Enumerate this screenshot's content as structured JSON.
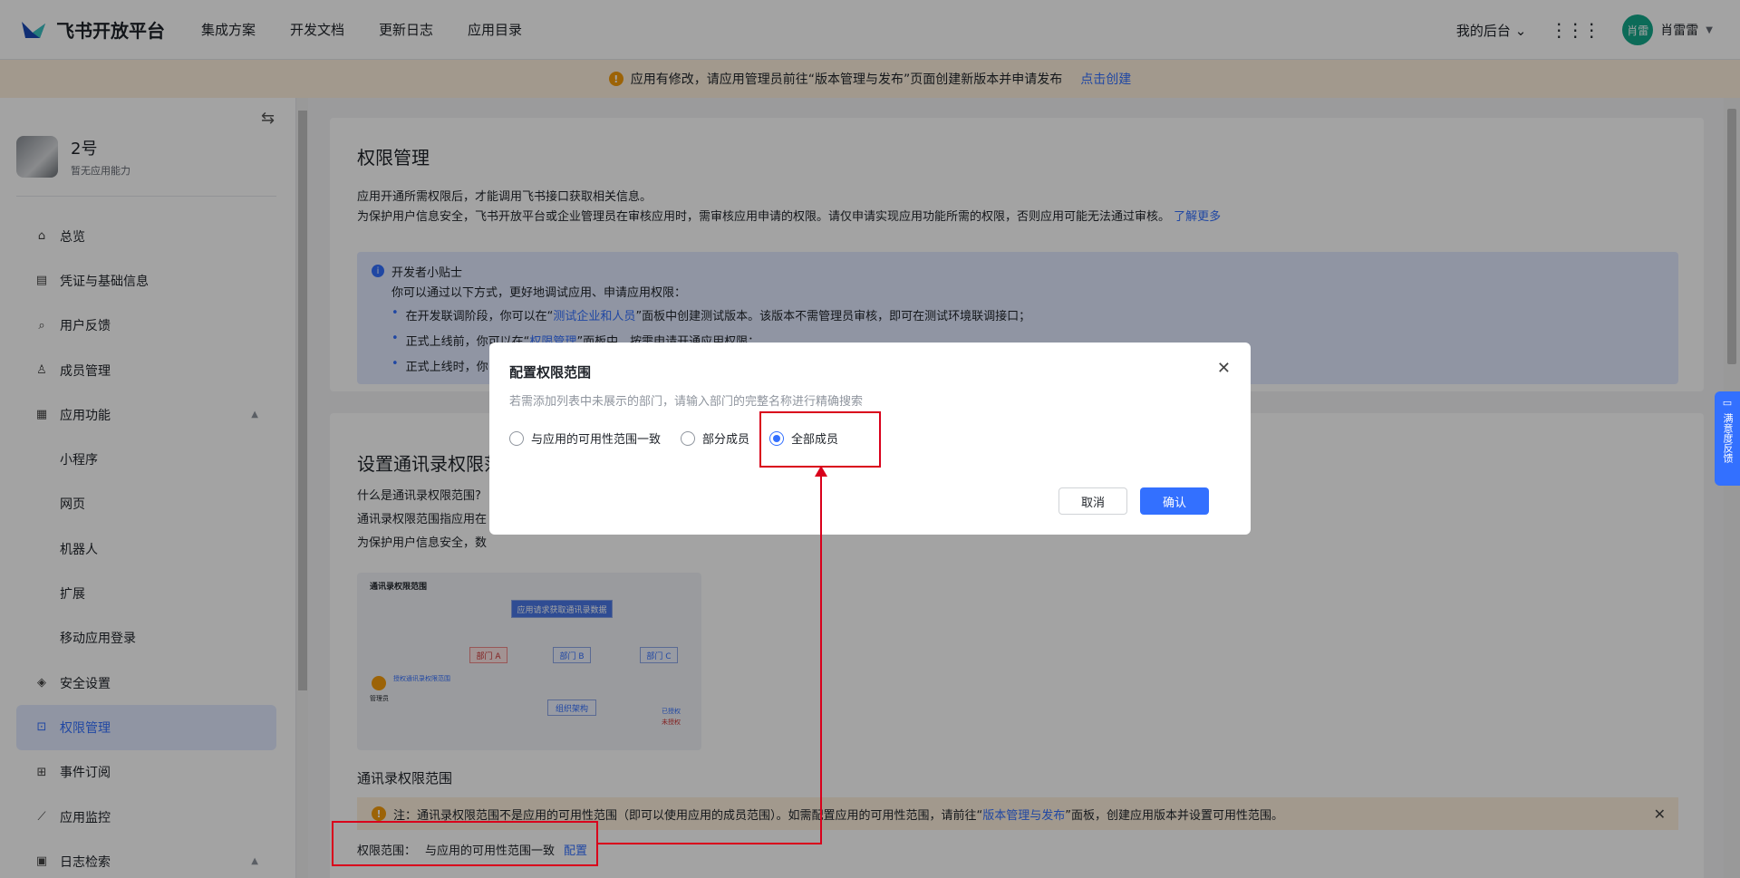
{
  "topbar": {
    "logo_text": "飞书开放平台",
    "nav": [
      "集成方案",
      "开发文档",
      "更新日志",
      "应用目录"
    ],
    "console": "我的后台",
    "avatar_text": "肖雷",
    "user_name": "肖雷雷"
  },
  "banner": {
    "text": "应用有修改，请应用管理员前往“版本管理与发布”页面创建新版本并申请发布",
    "link": "点击创建"
  },
  "sidebar": {
    "app_name": "2号",
    "app_sub": "暂无应用能力",
    "items": [
      {
        "label": "总览",
        "icon": "home-icon"
      },
      {
        "label": "凭证与基础信息",
        "icon": "credential-icon"
      },
      {
        "label": "用户反馈",
        "icon": "feedback-icon"
      },
      {
        "label": "成员管理",
        "icon": "user-icon"
      },
      {
        "label": "应用功能",
        "icon": "apps-icon"
      },
      {
        "label": "小程序"
      },
      {
        "label": "网页"
      },
      {
        "label": "机器人"
      },
      {
        "label": "扩展"
      },
      {
        "label": "移动应用登录"
      },
      {
        "label": "安全设置",
        "icon": "shield-icon"
      },
      {
        "label": "权限管理",
        "icon": "lock-icon"
      },
      {
        "label": "事件订阅",
        "icon": "event-icon"
      },
      {
        "label": "应用监控",
        "icon": "chart-icon"
      },
      {
        "label": "日志检索",
        "icon": "log-icon"
      }
    ]
  },
  "main": {
    "title": "权限管理",
    "desc1": "应用开通所需权限后，才能调用飞书接口获取相关信息。",
    "desc2": "为保护用户信息安全，飞书开放平台或企业管理员在审核应用时，需审核应用申请的权限。请仅申请实现应用功能所需的权限，否则应用可能无法通过审核。",
    "learn_more": "了解更多",
    "tip_title": "开发者小贴士",
    "tip_line": "你可以通过以下方式，更好地调试应用、申请应用权限：",
    "tip_b1_pre": "在开发联调阶段，你可以在“",
    "tip_b1_link": "测试企业和人员",
    "tip_b1_post": "”面板中创建测试版本。该版本不需管理员审核，即可在测试环境联调接口；",
    "tip_b2_pre": "正式上线前，你可以在“",
    "tip_b2_link": "权限管理",
    "tip_b2_post": "”面板中，按需申请开通应用权限；",
    "tip_b3": "正式上线时，你",
    "section_title": "设置通讯录权限范围",
    "q1": "什么是通讯录权限范围?",
    "q2": "通讯录权限范围指应用在",
    "q3": "为保护用户信息安全，数",
    "diagram": {
      "title": "通讯录权限范围",
      "top": "应用请求获取通讯录数据",
      "a": "部门 A",
      "b": "部门 B",
      "c": "部门 C",
      "org": "组织架构",
      "admin_line": "授权通讯录权限范围",
      "admin": "管理员",
      "legend1": "已授权",
      "legend2": "未授权"
    },
    "scope_heading": "通讯录权限范围",
    "note": "注：通讯录权限范围不是应用的可用性范围（即可以使用应用的成员范围）。如需配置应用的可用性范围，请前往“",
    "note_link": "版本管理与发布",
    "note_post": "”面板，创建应用版本并设置可用性范围。",
    "scope_label": "权限范围：",
    "scope_value": "与应用的可用性范围一致",
    "scope_config": "配置"
  },
  "modal": {
    "title": "配置权限范围",
    "desc": "若需添加列表中未展示的部门，请输入部门的完整名称进行精确搜索",
    "options": [
      "与应用的可用性范围一致",
      "部分成员",
      "全部成员"
    ],
    "selected": "全部成员",
    "cancel": "取消",
    "confirm": "确认"
  },
  "feedback_tab": "满意度反馈",
  "colors": {
    "accent": "#3370ff",
    "highlight": "#d9001b",
    "warning": "#f59b0b"
  }
}
